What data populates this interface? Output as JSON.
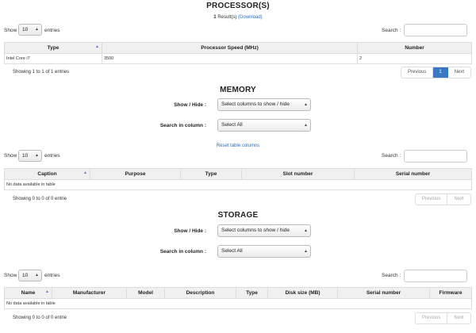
{
  "processors": {
    "title": "PROCESSOR(S)",
    "results_count": "1",
    "results_label": "Result(s)",
    "download": "(Download)",
    "show_label": "Show",
    "entries_label": "entries",
    "page_length": "10",
    "search_label": "Search :",
    "columns": [
      "Type",
      "Processor Speed (MHz)",
      "Number"
    ],
    "rows": [
      [
        "Intel Core i7",
        "3500",
        "2"
      ]
    ],
    "info": "Showing 1 to 1 of 1 entries",
    "pagination": {
      "previous": "Previous",
      "page": "1",
      "next": "Next"
    }
  },
  "memory": {
    "title": "MEMORY",
    "show_hide_label": "Show / Hide :",
    "show_hide_value": "Select columns to show / hide",
    "search_in_label": "Search in column :",
    "search_in_value": "Select All",
    "reset_link": "Reset table columns",
    "show_label": "Show",
    "entries_label": "entries",
    "page_length": "10",
    "search_label": "Search :",
    "columns": [
      "Caption",
      "Purpose",
      "Type",
      "Slot number",
      "Serial number"
    ],
    "empty": "No data available in table",
    "info": "Showing 0 to 0 of 0 entrie",
    "pagination": {
      "previous": "Previous",
      "next": "Next"
    }
  },
  "storage": {
    "title": "STORAGE",
    "show_hide_label": "Show / Hide :",
    "show_hide_value": "Select columns to show / hide",
    "search_in_label": "Search in column :",
    "search_in_value": "Select All",
    "show_label": "Show",
    "entries_label": "entries",
    "page_length": "10",
    "search_label": "Search :",
    "columns": [
      "Name",
      "Manufacturer",
      "Model",
      "Description",
      "Type",
      "Disk size (MB)",
      "Serial number",
      "Firmware"
    ],
    "empty": "No data available in table",
    "info": "Showing 0 to 0 of 0 entrie",
    "pagination": {
      "previous": "Previous",
      "next": "Next"
    }
  },
  "icons": {
    "sort": "sort-ascending-icon",
    "select_arrow": "select-arrows-icon"
  },
  "colors": {
    "accent": "#3a78c3",
    "link": "#2a6ebb",
    "header_bg": "#f0f0f0",
    "sort_icon": "#6b6bdc"
  }
}
